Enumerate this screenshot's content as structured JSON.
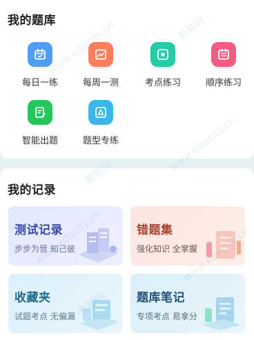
{
  "bank": {
    "title": "我的题库",
    "items": [
      {
        "label": "每日一练",
        "color": "#4f9cf3",
        "icon": "calendar-icon"
      },
      {
        "label": "每周一测",
        "color": "#fb7e5b",
        "icon": "chart-icon"
      },
      {
        "label": "考点练习",
        "color": "#26cca6",
        "icon": "star-icon"
      },
      {
        "label": "顺序练习",
        "color": "#f65c82",
        "icon": "list-icon"
      },
      {
        "label": "智能出题",
        "color": "#23c75c",
        "icon": "edit-icon"
      },
      {
        "label": "题型专练",
        "color": "#3ab6e9",
        "icon": "triangle-icon"
      }
    ]
  },
  "records": {
    "title": "我的记录",
    "cards": [
      {
        "title": "测试记录",
        "sub": "步步为营 知己彼"
      },
      {
        "title": "错题集",
        "sub": "强化知识 全掌握"
      },
      {
        "title": "收藏夹",
        "sub": "试题考点 无偏漏"
      },
      {
        "title": "题库笔记",
        "sub": "专项考点 易拿分"
      }
    ]
  },
  "watermark": {
    "site": "www.educity.cn",
    "brand": "希赛网"
  }
}
